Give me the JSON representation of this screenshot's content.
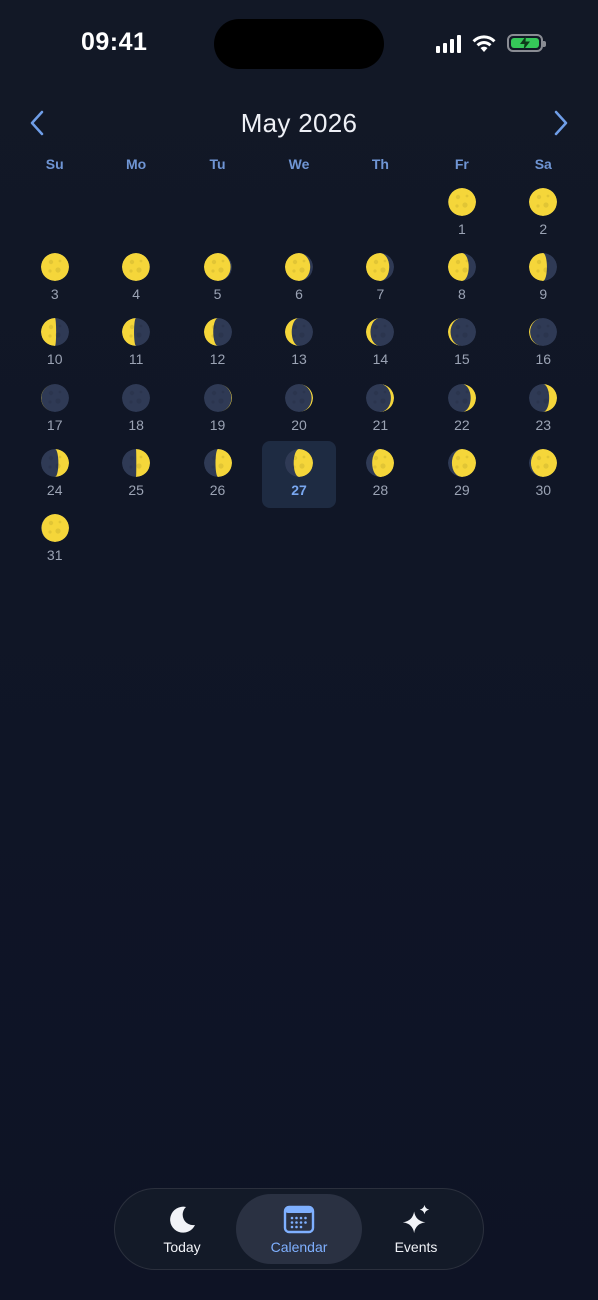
{
  "status_bar": {
    "time": "09:41"
  },
  "calendar": {
    "month_title": "May 2026",
    "weekdays": [
      "Su",
      "Mo",
      "Tu",
      "We",
      "Th",
      "Fr",
      "Sa"
    ],
    "leading_empty_days": 5,
    "selected_day": 27,
    "days": [
      {
        "day": "1",
        "phase": 0.46,
        "illumination": 0.99
      },
      {
        "day": "2",
        "phase": 0.48,
        "illumination": 1.0
      },
      {
        "day": "3",
        "phase": 0.5,
        "illumination": 1.0
      },
      {
        "day": "4",
        "phase": 0.52,
        "illumination": 0.99
      },
      {
        "day": "5",
        "phase": 0.55,
        "illumination": 0.95
      },
      {
        "day": "6",
        "phase": 0.58,
        "illumination": 0.9
      },
      {
        "day": "7",
        "phase": 0.61,
        "illumination": 0.83
      },
      {
        "day": "8",
        "phase": 0.64,
        "illumination": 0.74
      },
      {
        "day": "9",
        "phase": 0.67,
        "illumination": 0.64
      },
      {
        "day": "10",
        "phase": 0.71,
        "illumination": 0.54
      },
      {
        "day": "11",
        "phase": 0.74,
        "illumination": 0.43
      },
      {
        "day": "12",
        "phase": 0.77,
        "illumination": 0.33
      },
      {
        "day": "13",
        "phase": 0.81,
        "illumination": 0.24
      },
      {
        "day": "14",
        "phase": 0.84,
        "illumination": 0.16
      },
      {
        "day": "15",
        "phase": 0.88,
        "illumination": 0.09
      },
      {
        "day": "16",
        "phase": 0.91,
        "illumination": 0.04
      },
      {
        "day": "17",
        "phase": 0.95,
        "illumination": 0.01
      },
      {
        "day": "18",
        "phase": 0.0,
        "illumination": 0.0
      },
      {
        "day": "19",
        "phase": 0.04,
        "illumination": 0.02
      },
      {
        "day": "20",
        "phase": 0.07,
        "illumination": 0.05
      },
      {
        "day": "21",
        "phase": 0.11,
        "illumination": 0.11
      },
      {
        "day": "22",
        "phase": 0.14,
        "illumination": 0.19
      },
      {
        "day": "23",
        "phase": 0.18,
        "illumination": 0.28
      },
      {
        "day": "24",
        "phase": 0.21,
        "illumination": 0.38
      },
      {
        "day": "25",
        "phase": 0.25,
        "illumination": 0.49
      },
      {
        "day": "26",
        "phase": 0.28,
        "illumination": 0.59
      },
      {
        "day": "27",
        "phase": 0.32,
        "illumination": 0.69
      },
      {
        "day": "28",
        "phase": 0.35,
        "illumination": 0.78
      },
      {
        "day": "29",
        "phase": 0.39,
        "illumination": 0.86
      },
      {
        "day": "30",
        "phase": 0.42,
        "illumination": 0.93
      },
      {
        "day": "31",
        "phase": 0.46,
        "illumination": 0.98
      }
    ]
  },
  "tab_bar": {
    "tabs": [
      {
        "label": "Today",
        "icon": "crescent-moon-icon"
      },
      {
        "label": "Calendar",
        "icon": "calendar-icon"
      },
      {
        "label": "Events",
        "icon": "sparkles-icon"
      }
    ],
    "active": "Calendar"
  },
  "colors": {
    "moon_lit": "#f5d63a",
    "moon_dark": "#2f3a55",
    "accent": "#79a7f0",
    "weekday": "#6f95d4",
    "background": "#111827"
  }
}
